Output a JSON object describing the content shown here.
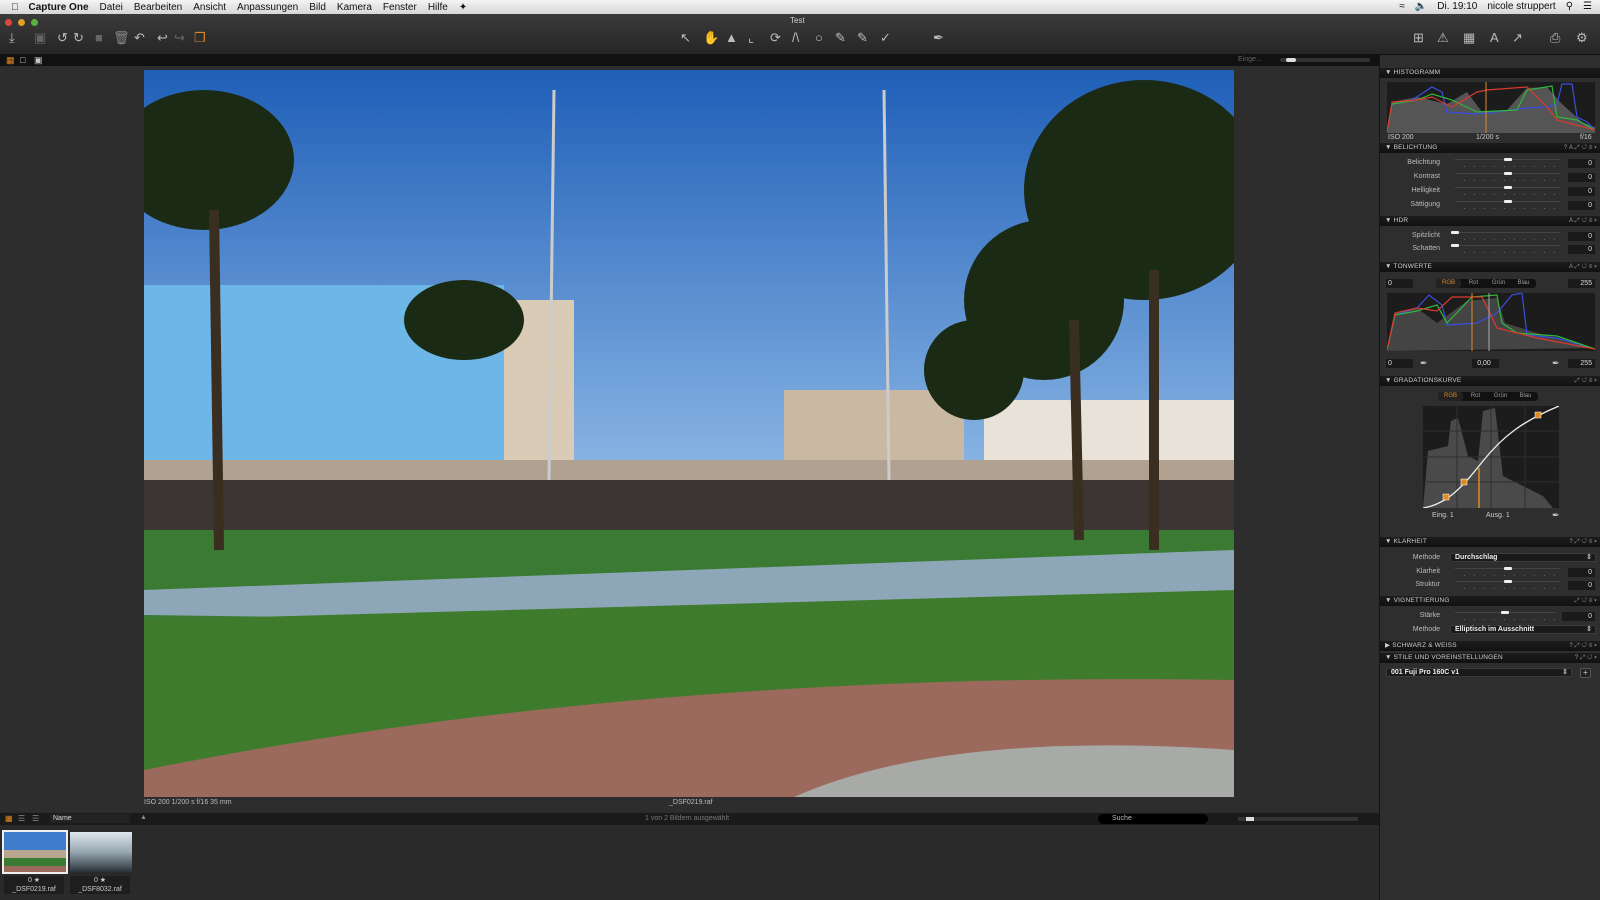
{
  "menubar": {
    "app": "Capture One",
    "items": [
      "Datei",
      "Bearbeiten",
      "Ansicht",
      "Anpassungen",
      "Bild",
      "Kamera",
      "Fenster",
      "Hilfe"
    ],
    "clock": "Di. 19:10",
    "user": "nicole struppert"
  },
  "window": {
    "title": "Test"
  },
  "viewer": {
    "caption_left": "ISO 200   1/200 s   f/16   35 mm",
    "filename": "_DSF0219.raf",
    "zoom_label": "Einge..."
  },
  "browser": {
    "sort": "Name",
    "status": "1 von 2 Bildern ausgewählt",
    "search_placeholder": "Suche",
    "thumbs": [
      {
        "name": "_DSF0219.raf",
        "rating": "0 ★",
        "selected": true
      },
      {
        "name": "_DSF8032.raf",
        "rating": "0 ★",
        "selected": false
      }
    ]
  },
  "panel": {
    "histogram": {
      "title": "HISTOGRAMM",
      "iso": "ISO 200",
      "shutter": "1/200 s",
      "aperture": "f/16"
    },
    "exposure": {
      "title": "BELICHTUNG",
      "rows": [
        {
          "label": "Belichtung",
          "value": "0",
          "pos": 0.5
        },
        {
          "label": "Kontrast",
          "value": "0",
          "pos": 0.5
        },
        {
          "label": "Helligkeit",
          "value": "0",
          "pos": 0.5
        },
        {
          "label": "Sättigung",
          "value": "0",
          "pos": 0.5
        }
      ]
    },
    "hdr": {
      "title": "HDR",
      "rows": [
        {
          "label": "Spitzlicht",
          "value": "0",
          "pos": 0
        },
        {
          "label": "Schatten",
          "value": "0",
          "pos": 0
        }
      ]
    },
    "levels": {
      "title": "TONWERTE",
      "in_low": "0",
      "in_high": "255",
      "out_low": "0",
      "mid": "0,00",
      "out_high": "255",
      "channels": [
        "RGB",
        "Rot",
        "Grün",
        "Blau"
      ]
    },
    "curve": {
      "title": "GRADATIONSKURVE",
      "channels": [
        "RGB",
        "Rot",
        "Grün",
        "Blau"
      ],
      "input": "Eing.  1",
      "output": "Ausg.  1"
    },
    "clarity": {
      "title": "KLARHEIT",
      "method_label": "Methode",
      "method": "Durchschlag",
      "rows": [
        {
          "label": "Klarheit",
          "value": "0",
          "pos": 0.5
        },
        {
          "label": "Struktur",
          "value": "0",
          "pos": 0.5
        }
      ]
    },
    "vignette": {
      "title": "VIGNETTIERUNG",
      "strength_label": "Stärke",
      "strength": "0",
      "pos": 0.5,
      "method_label": "Methode",
      "method": "Elliptisch im Ausschnitt"
    },
    "bw": {
      "title": "SCHWARZ & WEISS"
    },
    "styles": {
      "title": "STILE UND VOREINSTELLUNGEN",
      "preset": "001 Fuji Pro 160C v1",
      "add": "+"
    }
  }
}
